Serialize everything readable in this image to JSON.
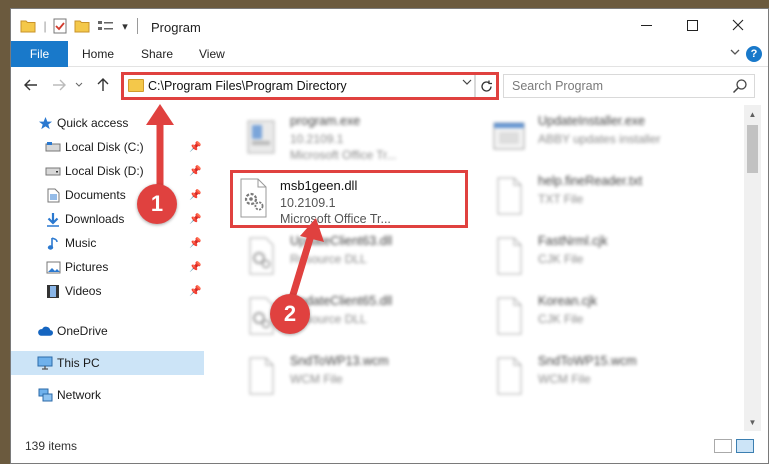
{
  "window": {
    "title": "Program",
    "qa_dropdown": "▾"
  },
  "ribbon": {
    "tabs": [
      "File",
      "Home",
      "Share",
      "View"
    ],
    "help": "?"
  },
  "nav": {
    "address": "C:\\Program Files\\Program Directory",
    "search_placeholder": "Search Program"
  },
  "sidebar": {
    "items": [
      {
        "label": "Quick access",
        "icon": "star-icon",
        "pinned": false
      },
      {
        "label": "Local Disk (C:)",
        "icon": "drive-icon",
        "pinned": true
      },
      {
        "label": "Local Disk (D:)",
        "icon": "drive-icon",
        "pinned": true
      },
      {
        "label": "Documents",
        "icon": "document-icon",
        "pinned": true
      },
      {
        "label": "Downloads",
        "icon": "download-icon",
        "pinned": true
      },
      {
        "label": "Music",
        "icon": "music-icon",
        "pinned": true
      },
      {
        "label": "Pictures",
        "icon": "pictures-icon",
        "pinned": true
      },
      {
        "label": "Videos",
        "icon": "video-icon",
        "pinned": true
      },
      {
        "label": "OneDrive",
        "icon": "cloud-icon",
        "pinned": false
      },
      {
        "label": "This PC",
        "icon": "computer-icon",
        "pinned": false,
        "selected": true
      },
      {
        "label": "Network",
        "icon": "network-icon",
        "pinned": false
      }
    ]
  },
  "files": [
    {
      "name": "program.exe",
      "line1": "10.2109.1",
      "line2": "Microsoft Office Tr..."
    },
    {
      "name": "UpdateInstaller.exe",
      "line1": "ABBY updates installer",
      "line2": ""
    },
    {
      "name": "msb1geen.dll",
      "line1": "10.2109.1",
      "line2": "Microsoft Office Tr..."
    },
    {
      "name": "help.fineReader.txt",
      "line1": "TXT File",
      "line2": ""
    },
    {
      "name": "UpdateClient63.dll",
      "line1": "Resource DLL",
      "line2": ""
    },
    {
      "name": "FastNrml.cjk",
      "line1": "CJK File",
      "line2": ""
    },
    {
      "name": "UpdateClient65.dll",
      "line1": "Resource DLL",
      "line2": ""
    },
    {
      "name": "Korean.cjk",
      "line1": "CJK File",
      "line2": ""
    },
    {
      "name": "SndToWP13.wcm",
      "line1": "WCM File",
      "line2": ""
    },
    {
      "name": "SndToWP15.wcm",
      "line1": "WCM File",
      "line2": ""
    }
  ],
  "status": {
    "count": "139 items"
  },
  "annotations": {
    "marker1": "1",
    "marker2": "2",
    "color": "#e0413f"
  },
  "colors": {
    "accent": "#1979ca",
    "selected_bg": "#cce4f7"
  }
}
